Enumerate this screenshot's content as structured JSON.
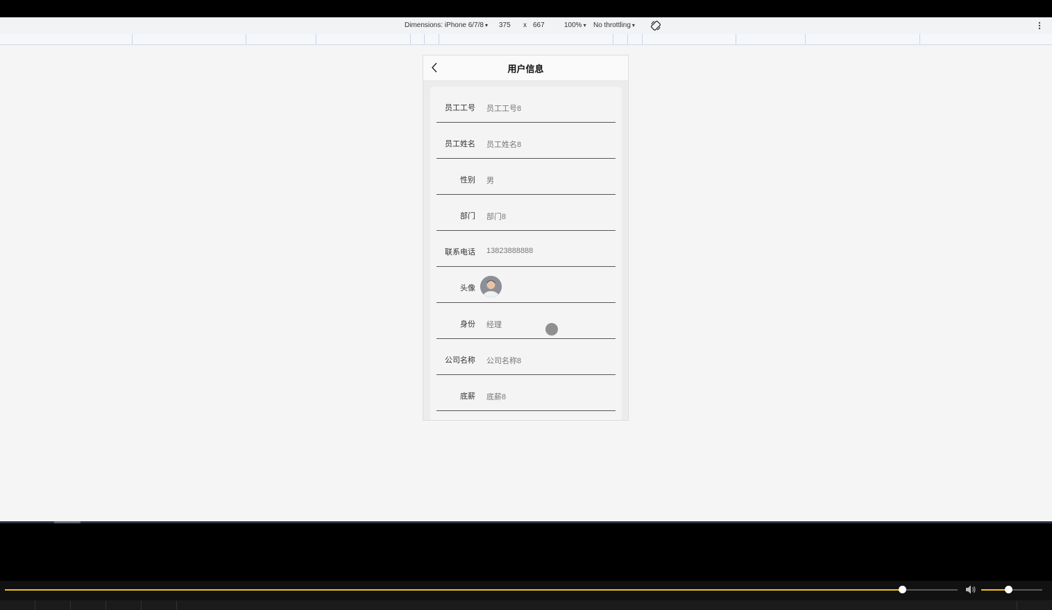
{
  "devtools": {
    "dimensions_label": "Dimensions: iPhone 6/7/8",
    "width": "375",
    "times": "x",
    "height": "667",
    "zoom": "100%",
    "throttling": "No throttling",
    "caret": "▾"
  },
  "nav": {
    "title": "用户信息"
  },
  "fields": [
    {
      "label": "员工工号",
      "value": "员工工号8"
    },
    {
      "label": "员工姓名",
      "value": "员工姓名8"
    },
    {
      "label": "性别",
      "value": "男"
    },
    {
      "label": "部门",
      "value": "部门8"
    },
    {
      "label": "联系电话",
      "value": "13823888888"
    },
    {
      "label": "头像",
      "value": ""
    },
    {
      "label": "身份",
      "value": "经理"
    },
    {
      "label": "公司名称",
      "value": "公司名称8"
    },
    {
      "label": "底薪",
      "value": "底薪8"
    }
  ],
  "player": {
    "progress": 0.942,
    "volume": 0.44
  },
  "colors": {
    "accent": "#f0c419"
  }
}
